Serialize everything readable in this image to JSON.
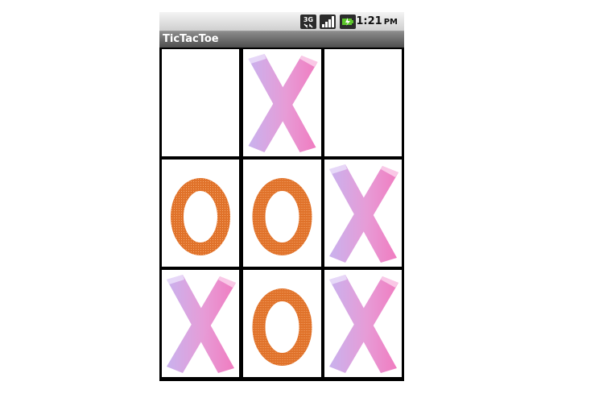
{
  "status_bar": {
    "network_label": "3G",
    "time": "1:21",
    "ampm": "PM",
    "icons": [
      "3g-icon",
      "signal-icon",
      "battery-icon"
    ]
  },
  "app": {
    "title": "TicTacToe"
  },
  "board": {
    "cells": [
      "",
      "X",
      "",
      "O",
      "O",
      "X",
      "X",
      "O",
      "X"
    ]
  },
  "colors": {
    "x_light": "#c9b2ee",
    "x_pink": "#f07cc0",
    "o_orange": "#e0722a",
    "grid": "#000000"
  }
}
